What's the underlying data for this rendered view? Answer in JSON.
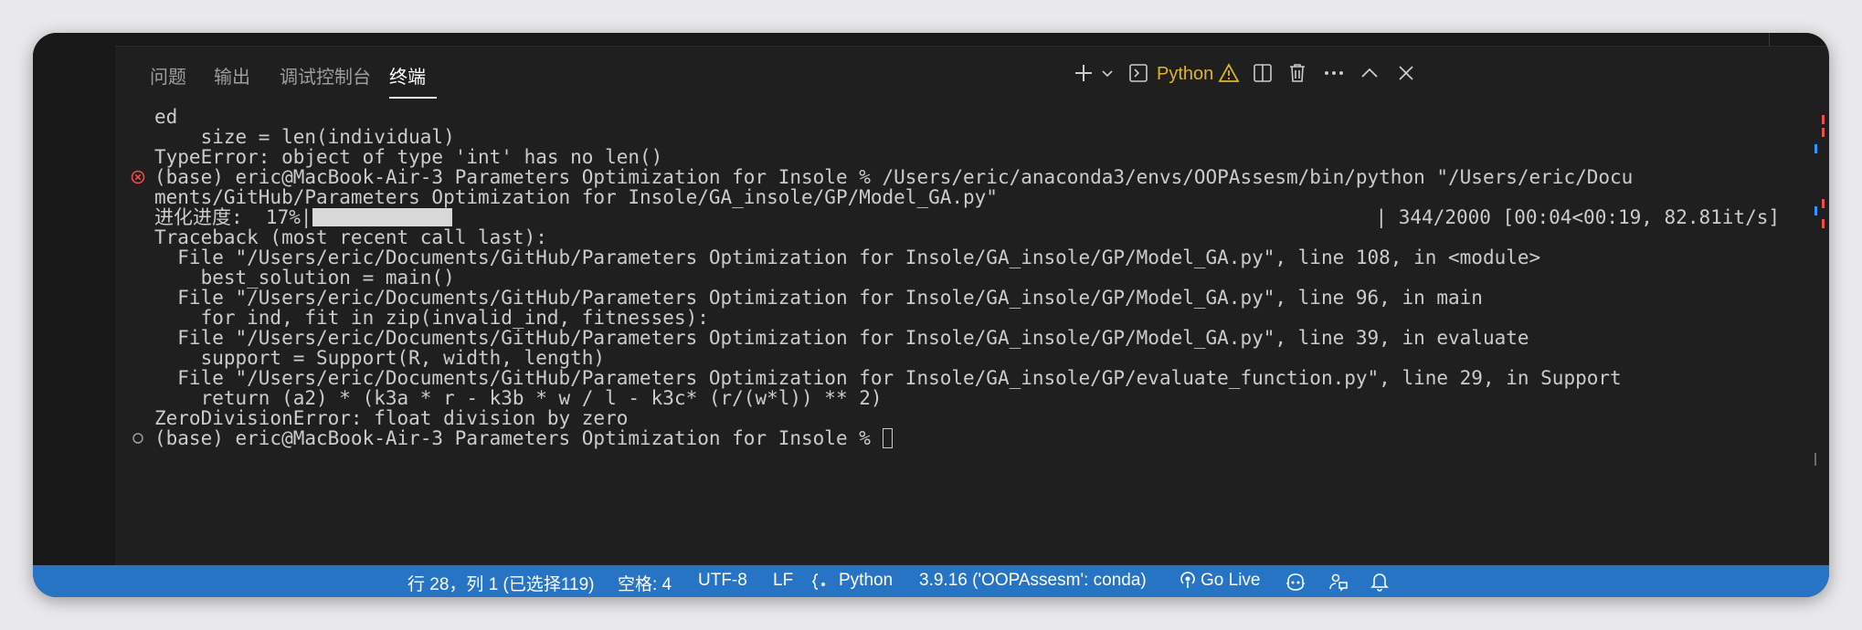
{
  "panel": {
    "tabs": [
      {
        "label": "问题"
      },
      {
        "label": "输出"
      },
      {
        "label": "调试控制台"
      },
      {
        "label": "终端",
        "active": true
      }
    ],
    "toolbar": {
      "add_terminal_icon": "plus-icon",
      "dropdown_icon": "chevron-down-icon",
      "terminal_profile_label": "Python",
      "warning_icon": "warning-icon",
      "split_icon": "split-terminal-icon",
      "trash_icon": "trash-icon",
      "more_icon": "ellipsis-icon",
      "maximize_icon": "chevron-up-icon",
      "close_icon": "close-icon"
    },
    "colors": {
      "accent": "#2774c5",
      "warning": "#e0b52a",
      "error": "#f14c4c",
      "background": "#1f1f1f"
    }
  },
  "terminal": {
    "lines": [
      "ed",
      "    size = len(individual)",
      "TypeError: object of type 'int' has no len()",
      "(base) eric@MacBook-Air-3 Parameters Optimization for Insole % /Users/eric/anaconda3/envs/OOPAssesm/bin/python \"/Users/eric/Docu",
      "ments/GitHub/Parameters Optimization for Insole/GA_insole/GP/Model_GA.py\"",
      "进化进度:  17%|",
      "Traceback (most recent call last):",
      "  File \"/Users/eric/Documents/GitHub/Parameters Optimization for Insole/GA_insole/GP/Model_GA.py\", line 108, in <module>",
      "    best_solution = main()",
      "  File \"/Users/eric/Documents/GitHub/Parameters Optimization for Insole/GA_insole/GP/Model_GA.py\", line 96, in main",
      "    for ind, fit in zip(invalid_ind, fitnesses):",
      "  File \"/Users/eric/Documents/GitHub/Parameters Optimization for Insole/GA_insole/GP/Model_GA.py\", line 39, in evaluate",
      "    support = Support(R, width, length)",
      "  File \"/Users/eric/Documents/GitHub/Parameters Optimization for Insole/GA_insole/GP/evaluate_function.py\", line 29, in Support",
      "    return (a2) * (k3a * r - k3b * w / l - k3c* (r/(w*l)) ** 2)",
      "ZeroDivisionError: float division by zero",
      "(base) eric@MacBook-Air-3 Parameters Optimization for Insole % "
    ],
    "progress": {
      "percent": 17,
      "stats": "| 344/2000 [00:04<00:19, 82.81it/s]"
    },
    "error_marker_icon": "error-circle-icon",
    "prompt_marker_icon": "circle-outline-icon"
  },
  "statusbar": {
    "cursor_position": "行 28，列 1 (已选择119)",
    "indent": "空格: 4",
    "encoding": "UTF-8",
    "eol": "LF",
    "language": "Python",
    "interpreter": "3.9.16 ('OOPAssesm': conda)",
    "go_live": "Go Live",
    "language_icon": "braces-icon",
    "go_live_icon": "broadcast-icon",
    "copilot_icon": "copilot-icon",
    "feedback_icon": "feedback-icon",
    "notifications_icon": "bell-icon"
  }
}
